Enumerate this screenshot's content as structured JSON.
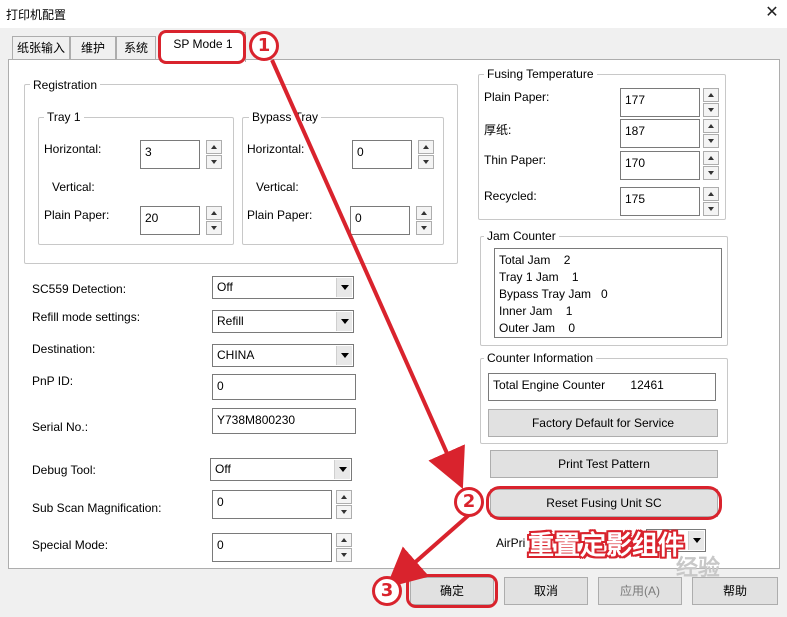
{
  "window": {
    "title": "打印机配置"
  },
  "tabs": [
    {
      "label": "纸张输入"
    },
    {
      "label": "维护"
    },
    {
      "label": "系统"
    },
    {
      "label": "SP Mode 1"
    }
  ],
  "registration": {
    "group_label": "Registration",
    "tray1": {
      "label": "Tray 1",
      "horizontal_label": "Horizontal:",
      "horizontal_value": "3",
      "vertical_label": "Vertical:",
      "plain_paper_label": "Plain Paper:",
      "plain_paper_value": "20"
    },
    "bypass": {
      "label": "Bypass Tray",
      "horizontal_label": "Horizontal:",
      "horizontal_value": "0",
      "vertical_label": "Vertical:",
      "plain_paper_label": "Plain Paper:",
      "plain_paper_value": "0"
    }
  },
  "settings": {
    "sc559_label": "SC559 Detection:",
    "sc559_value": "Off",
    "refill_label": "Refill mode settings:",
    "refill_value": "Refill",
    "destination_label": "Destination:",
    "destination_value": "CHINA",
    "pnp_label": "PnP ID:",
    "pnp_value": "0",
    "serial_label": "Serial No.:",
    "serial_value": "Y738M800230",
    "debug_label": "Debug Tool:",
    "debug_value": "Off",
    "subscan_label": "Sub Scan Magnification:",
    "subscan_value": "0",
    "special_label": "Special Mode:",
    "special_value": "0"
  },
  "fusing": {
    "group_label": "Fusing Temperature",
    "plain_label": "Plain Paper:",
    "plain_value": "177",
    "thick_label": "厚纸:",
    "thick_value": "187",
    "thin_label": "Thin Paper:",
    "thin_value": "170",
    "recycled_label": "Recycled:",
    "recycled_value": "175"
  },
  "jam_counter": {
    "group_label": "Jam Counter",
    "lines": [
      "Total Jam    2",
      "Tray 1 Jam    1",
      "Bypass Tray Jam   0",
      "Inner Jam    1",
      "Outer Jam    0"
    ]
  },
  "counter_info": {
    "group_label": "Counter Information",
    "total_engine_label": "Total Engine Counter",
    "total_engine_value": "12461",
    "factory_default_button": "Factory Default for Service"
  },
  "actions": {
    "print_test_pattern": "Print Test Pattern",
    "reset_fusing": "Reset Fusing Unit SC",
    "airprint_label": "AirPri"
  },
  "footer": {
    "ok": "确定",
    "cancel": "取消",
    "apply": "应用(A)",
    "help": "帮助"
  },
  "annotations": {
    "step1": "1",
    "step2": "2",
    "step3": "3",
    "caption": "重置定影组件",
    "watermark": "经验",
    "accent_color": "#d9232d"
  }
}
